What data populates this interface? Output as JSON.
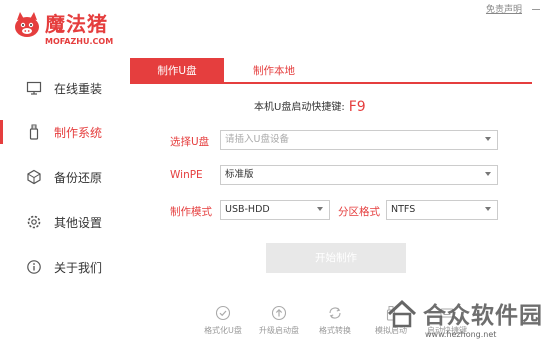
{
  "app": {
    "name_cn": "魔法猪",
    "name_en": "MOFAZHU.COM",
    "disclaimer": "免责声明",
    "brand_color": "#e53e3e"
  },
  "sidebar": {
    "items": [
      {
        "label": "在线重装",
        "icon": "monitor-icon",
        "active": false
      },
      {
        "label": "制作系统",
        "icon": "usb-icon",
        "active": true
      },
      {
        "label": "备份还原",
        "icon": "backup-icon",
        "active": false
      },
      {
        "label": "其他设置",
        "icon": "gear-icon",
        "active": false
      },
      {
        "label": "关于我们",
        "icon": "info-icon",
        "active": false
      }
    ]
  },
  "tabs": [
    {
      "label": "制作U盘",
      "active": true
    },
    {
      "label": "制作本地",
      "active": false
    }
  ],
  "form": {
    "hotkey_label": "本机U盘启动快捷键:",
    "hotkey_value": "F9",
    "usb_label": "选择U盘",
    "usb_placeholder": "请插入U盘设备",
    "winpe_label": "WinPE",
    "winpe_value": "标准版",
    "mode_label": "制作模式",
    "mode_value": "USB-HDD",
    "partition_label": "分区格式",
    "partition_value": "NTFS"
  },
  "start_button": "开始制作",
  "tools": [
    {
      "label": "格式化U盘",
      "icon": "check-circle-icon"
    },
    {
      "label": "升级启动盘",
      "icon": "upload-circle-icon"
    },
    {
      "label": "格式转换",
      "icon": "convert-icon"
    },
    {
      "label": "模拟启动",
      "icon": "simulate-icon"
    },
    {
      "label": "启动快捷键",
      "icon": "hotkey-icon"
    }
  ],
  "watermark": {
    "text": "合众软件园",
    "url": "www.hezhong.net"
  }
}
